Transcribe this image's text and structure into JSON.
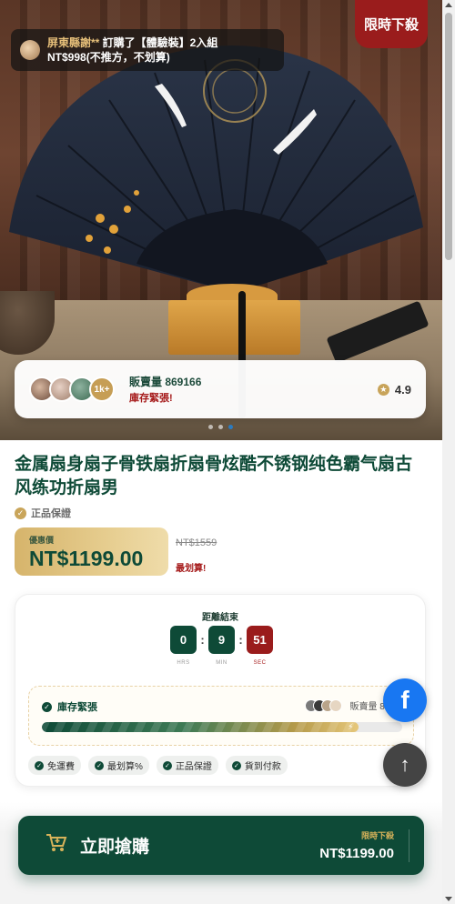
{
  "hero": {
    "badge": "限時下殺",
    "purchase_toast": {
      "buyer": "屏東縣謝**",
      "action": " 訂購了【體驗裝】2入組",
      "price_line": "NT$998(不推方，不划算)"
    },
    "stats": {
      "avatars_more": "1k+",
      "sold_label": "販賣量 869166",
      "stock_label": "庫存緊張!",
      "rating": "4.9"
    },
    "carousel": {
      "slide_count": 3,
      "active_index": 2
    }
  },
  "product": {
    "title": "金属扇身扇子骨铁扇折扇骨炫酷不锈钢纯色霸气扇古风练功折扇男",
    "guarantee": "正品保證",
    "price_label": "優惠價",
    "price": "NT$1199.00",
    "original_price": "NT$1559",
    "deal_text": "最划算!"
  },
  "countdown": {
    "title": "距離結束",
    "hours": "0",
    "minutes": "9",
    "seconds": "51",
    "hours_label": "HRS",
    "minutes_label": "MIN",
    "seconds_label": "SEC",
    "separator": ":"
  },
  "stock_panel": {
    "title": "庫存緊張",
    "sold_text": "販賣量 869",
    "progress": 0.88
  },
  "tags": [
    "免運費",
    "最划算%",
    "正品保證",
    "貨到付款"
  ],
  "buy_button": {
    "label": "立即搶購",
    "promo": "限時下殺",
    "price": "NT$1199.00"
  },
  "colors": {
    "primary": "#0e4a37",
    "gold": "#d8b35a",
    "alert": "#9a1c1c",
    "facebook": "#1877f2"
  },
  "icons": {
    "facebook": "facebook-icon",
    "scroll_top": "arrow-up-icon",
    "cart": "cart-icon"
  }
}
